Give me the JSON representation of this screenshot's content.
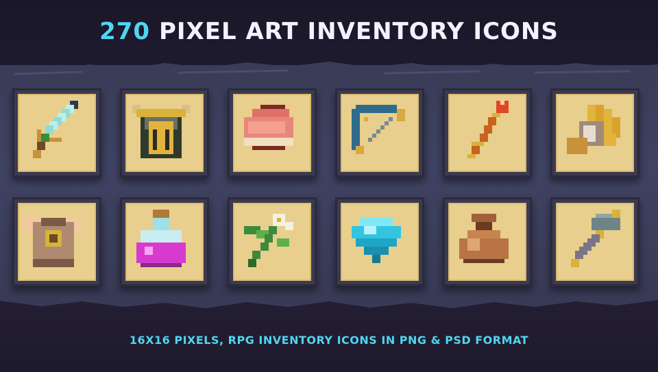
{
  "header": {
    "count": "270",
    "title_rest": "PIXEL ART INVENTORY ICONS"
  },
  "footer": {
    "subtitle": "16X16 PIXELS, RPG INVENTORY ICONS IN PNG & PSD FORMAT"
  },
  "colors": {
    "accent": "#4fd6f0",
    "title": "#f4f1ff",
    "tile_bg": "#e8cf8d",
    "tile_frame": "#3b3a4f"
  },
  "icons": {
    "row1": [
      "sword-icon",
      "horned-helmet-icon",
      "meat-steak-icon",
      "bow-icon",
      "fire-staff-icon",
      "gauntlet-icon"
    ],
    "row2": [
      "chest-armor-icon",
      "potion-icon",
      "herb-flower-icon",
      "diamond-gem-icon",
      "coin-bag-icon",
      "war-hammer-icon"
    ]
  }
}
